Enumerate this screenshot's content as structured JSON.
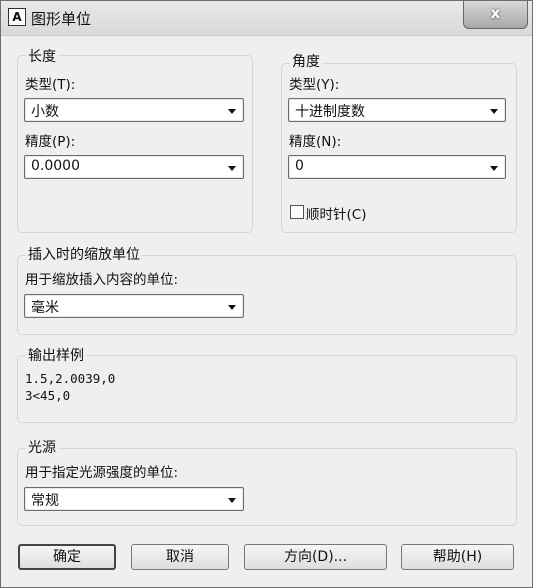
{
  "dialog": {
    "icon": "A",
    "title": "图形单位",
    "close_label": "x"
  },
  "length": {
    "title": "长度",
    "type_label": "类型(T):",
    "type_value": "小数",
    "precision_label": "精度(P):",
    "precision_value": "0.0000"
  },
  "angle": {
    "title": "角度",
    "type_label": "类型(Y):",
    "type_value": "十进制度数",
    "precision_label": "精度(N):",
    "precision_value": "0",
    "clockwise_label": "顺时针(C)",
    "clockwise_checked": false
  },
  "insert": {
    "title": "插入时的缩放单位",
    "label": "用于缩放插入内容的单位:",
    "value": "毫米"
  },
  "sample": {
    "title": "输出样例",
    "line1": "1.5,2.0039,0",
    "line2": "3<45,0"
  },
  "light": {
    "title": "光源",
    "label": "用于指定光源强度的单位:",
    "value": "常规"
  },
  "buttons": {
    "ok": "确定",
    "cancel": "取消",
    "direction": "方向(D)...",
    "help": "帮助(H)"
  }
}
